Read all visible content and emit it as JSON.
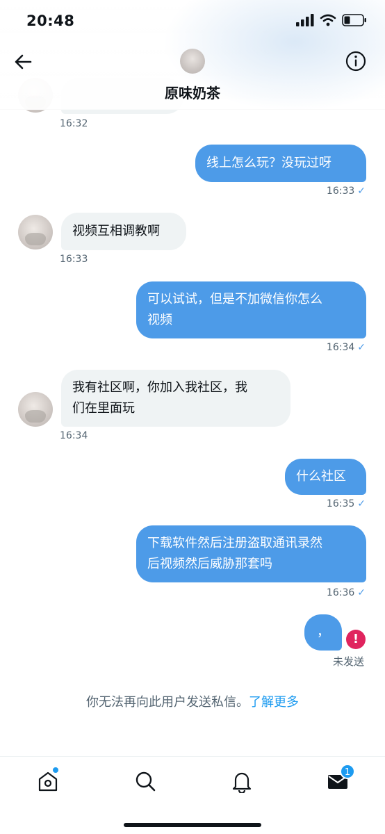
{
  "status": {
    "time": "20:48"
  },
  "header": {
    "name": "原味奶茶"
  },
  "messages": [
    {
      "dir": "in",
      "time": "16:32"
    },
    {
      "dir": "out",
      "text": "线上怎么玩？没玩过呀",
      "time": "16:33"
    },
    {
      "dir": "in",
      "text": "视频互相调教啊",
      "time": "16:33"
    },
    {
      "dir": "out",
      "lines": [
        "可以试试，但是不加微信你怎么",
        "视频"
      ],
      "time": "16:34"
    },
    {
      "dir": "in",
      "lines": [
        "我有社区啊，你加入我社区，我",
        "们在里面玩"
      ],
      "time": "16:34"
    },
    {
      "dir": "out",
      "text": "什么社区",
      "time": "16:35"
    },
    {
      "dir": "out",
      "lines": [
        "下载软件然后注册盗取通讯录然",
        "后视频然后威胁那套吗"
      ],
      "time": "16:36"
    },
    {
      "dir": "out",
      "text": "，",
      "status": "未发送",
      "failed_icon": "!"
    }
  ],
  "checkmark": "✓",
  "notice": {
    "text": "你无法再向此用户发送私信。",
    "link": "了解更多"
  },
  "nav": {
    "items": [
      "home-icon",
      "search-icon",
      "bell-icon",
      "mail-icon"
    ],
    "mail_badge": "1"
  },
  "colors": {
    "accent": "#1d9bf0",
    "bubble_out": "#4d9be8",
    "bubble_in": "#eff3f4",
    "error": "#e0245e"
  }
}
